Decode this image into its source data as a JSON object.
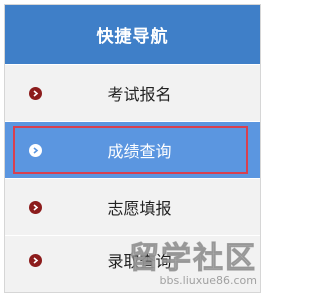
{
  "header": {
    "title": "快捷导航"
  },
  "menu": {
    "items": [
      {
        "label": "考试报名",
        "icon": "chevron-right-icon",
        "active": false
      },
      {
        "label": "成绩查询",
        "icon": "chevron-right-icon",
        "active": true
      },
      {
        "label": "志愿填报",
        "icon": "chevron-right-icon",
        "active": false
      },
      {
        "label": "录取查询",
        "icon": "chevron-right-icon",
        "active": false
      }
    ]
  },
  "watermark": {
    "brand": "留学社区",
    "url": "bbs.liuxue86.com"
  },
  "colors": {
    "header": "#3f7fc8",
    "active_row": "#5b96e0",
    "highlight_frame": "#d84050",
    "bullet": "#8c1c1c"
  }
}
